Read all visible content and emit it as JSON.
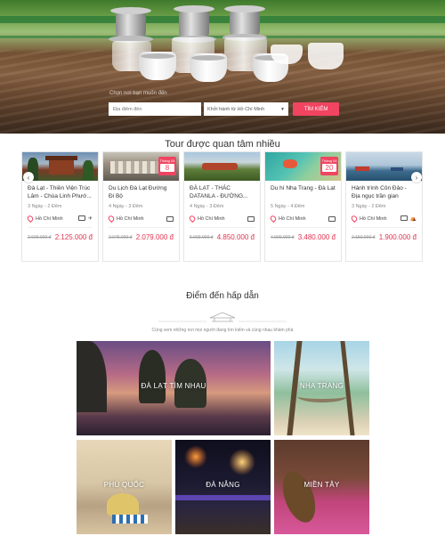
{
  "hero": {
    "search_hint": "Chọn nơi bạn muốn đến",
    "destination_placeholder": "Địa điểm đến",
    "departure_value": "Khởi hành từ Hồ Chí Minh",
    "search_button": "TÌM KIẾM"
  },
  "tours": {
    "title": "Tour được quan tâm nhiều",
    "items": [
      {
        "name": "Đà Lạt - Thiền Viện Trúc Lâm - Chùa Linh Phướ...",
        "duration": "3 Ngày - 2 Đêm",
        "location": "Hồ Chí Minh",
        "old_price": "2.600.000 đ",
        "price": "2.125.000 đ",
        "badge_month": "",
        "badge_day": ""
      },
      {
        "name": "Du Lịch Đà Lạt Đường Đi Bộ",
        "duration": "4 Ngày - 3 Đêm",
        "location": "Hồ Chí Minh",
        "old_price": "2.075.000 đ",
        "price": "2.079.000 đ",
        "badge_month": "Tháng 04",
        "badge_day": "8"
      },
      {
        "name": "ĐÀ LẠT - THÁC DATANLA - ĐƯỜNG...",
        "duration": "4 Ngày - 3 Đêm",
        "location": "Hồ Chí Minh",
        "old_price": "5.099.000 đ",
        "price": "4.850.000 đ",
        "badge_month": "",
        "badge_day": ""
      },
      {
        "name": "Du hí Nha Trang - Đà Lạt",
        "duration": "5 Ngày - 4 Đêm",
        "location": "Hồ Chí Minh",
        "old_price": "4.000.000 đ",
        "price": "3.480.000 đ",
        "badge_month": "Tháng 04",
        "badge_day": "20"
      },
      {
        "name": "Hành trình Côn Đảo - Địa ngục trần gian",
        "duration": "3 Ngày - 2 Đêm",
        "location": "Hồ Chí Minh",
        "old_price": "2.150.000 đ",
        "price": "1.900.000 đ",
        "badge_month": "",
        "badge_day": ""
      }
    ]
  },
  "destinations": {
    "title": "Điểm đến hấp dẫn",
    "subtitle": "Cùng xem những nơi mọi người đang tìm kiếm và cùng nhau khám phá",
    "items": [
      {
        "label": "ĐÀ LẠT TÌM NHAU"
      },
      {
        "label": "NHA TRANG"
      },
      {
        "label": "PHÚ QUỐC"
      },
      {
        "label": "ĐÀ NẴNG"
      },
      {
        "label": "MIỀN TÂY"
      }
    ]
  },
  "colors": {
    "accent": "#f04461",
    "price": "#e0334f"
  }
}
